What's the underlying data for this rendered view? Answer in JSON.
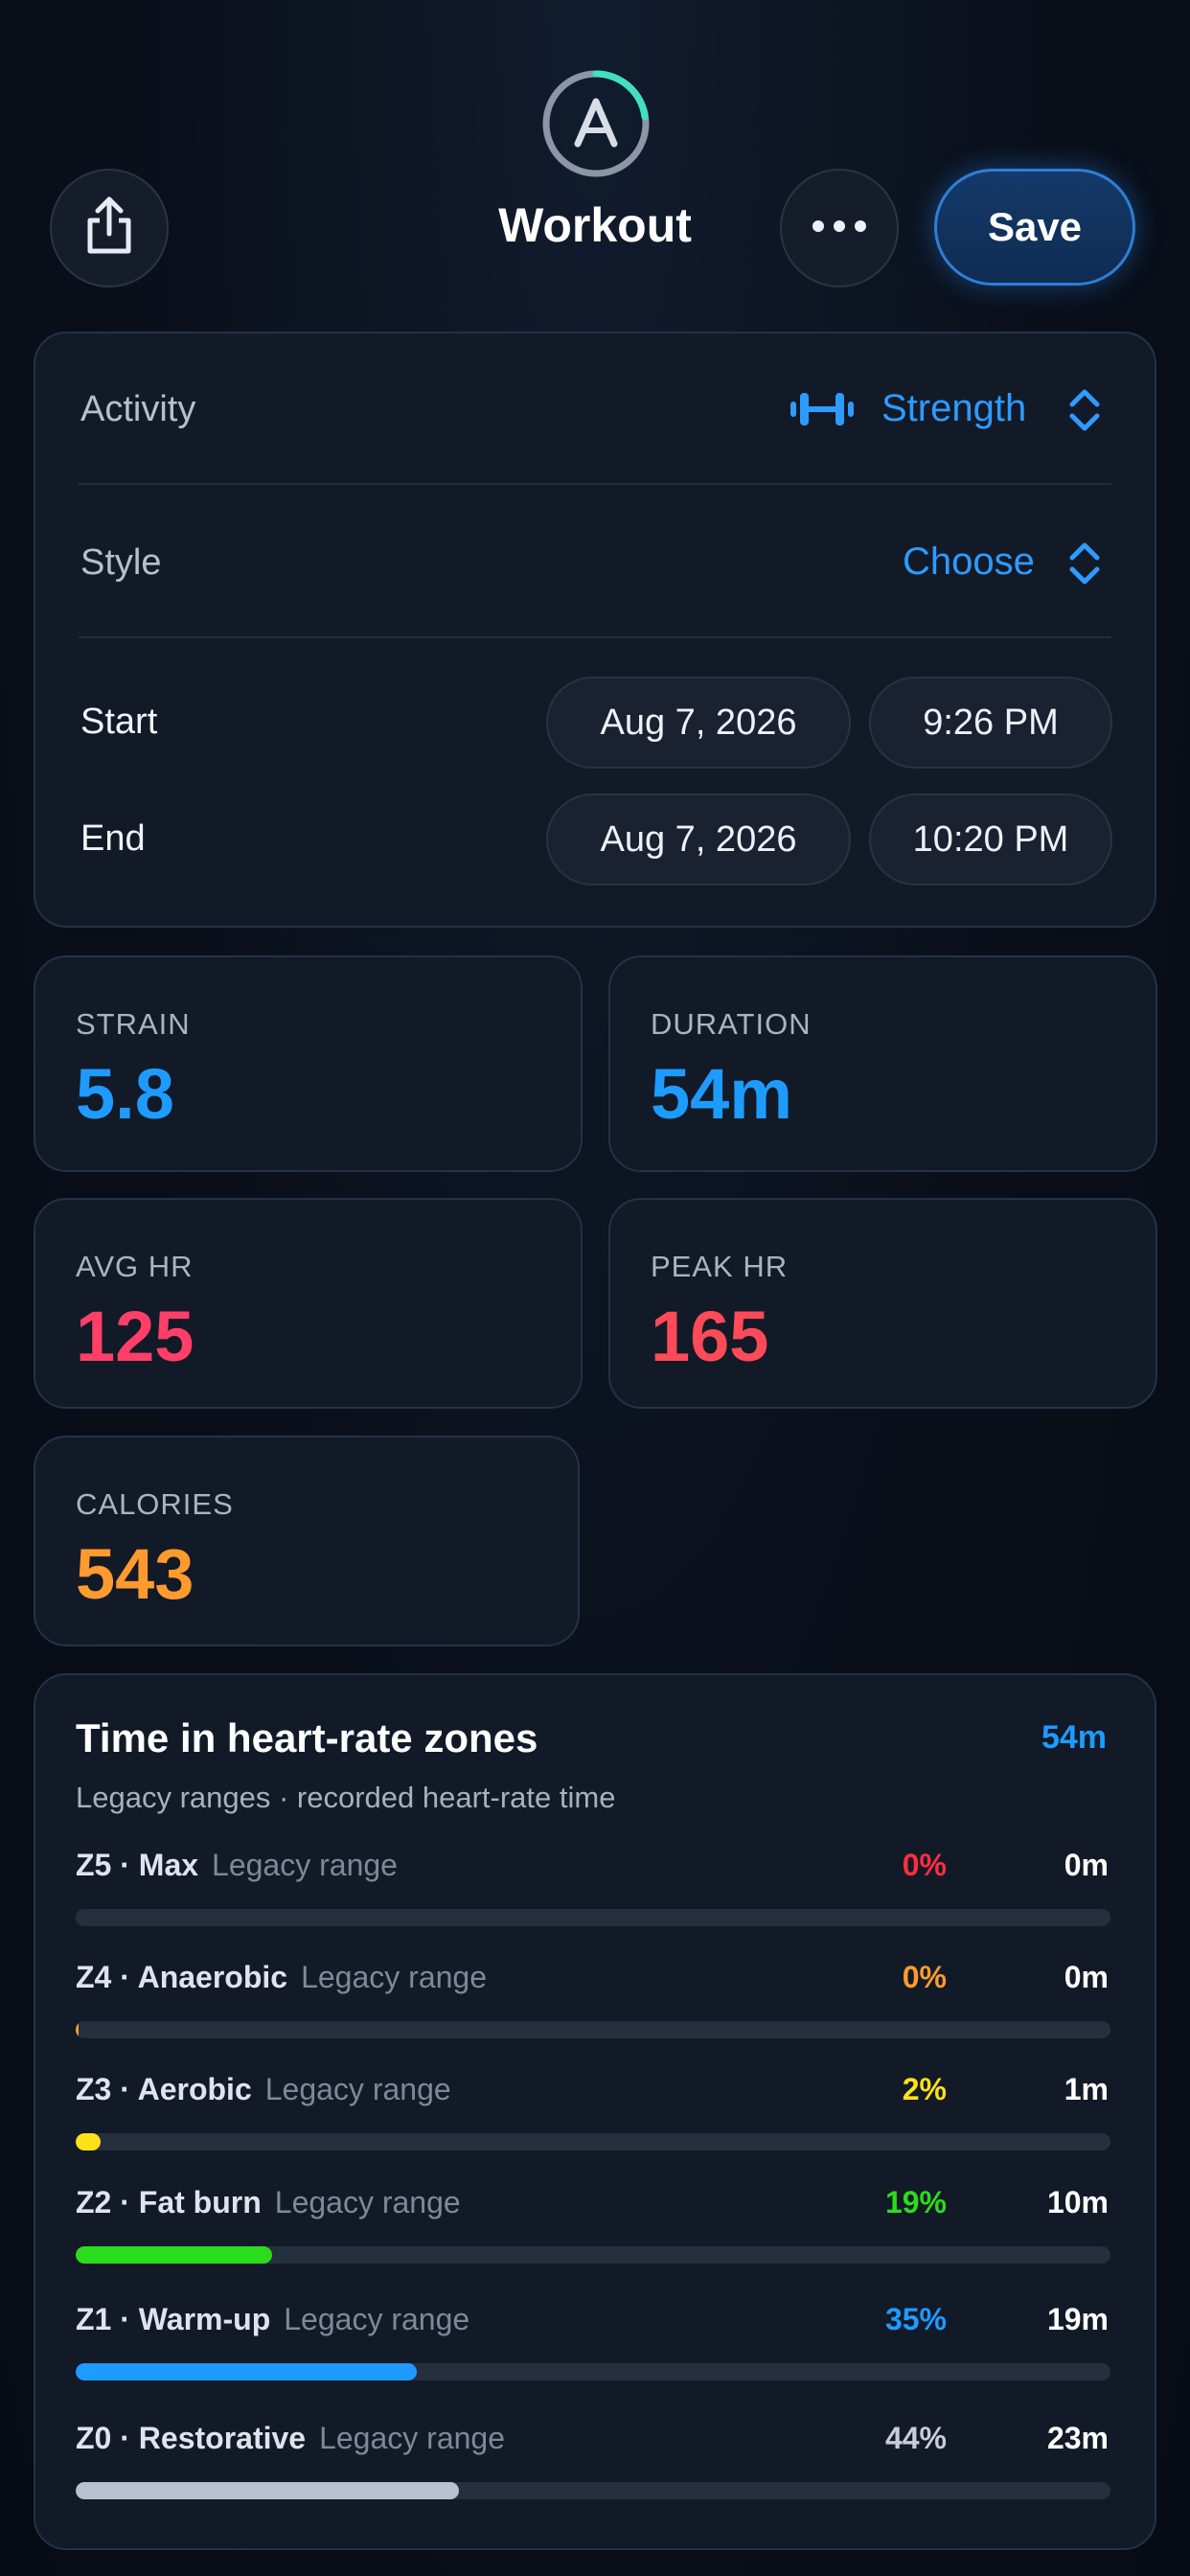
{
  "header": {
    "title": "Workout",
    "save_label": "Save",
    "logo_icon": "app-logo-icon",
    "share_icon": "share-icon",
    "more_icon": "more-icon"
  },
  "details": {
    "activity": {
      "label": "Activity",
      "value": "Strength",
      "icon": "dumbbell-icon"
    },
    "style": {
      "label": "Style",
      "value": "Choose"
    },
    "start": {
      "label": "Start",
      "date": "Aug 7, 2026",
      "time": "9:26 PM"
    },
    "end": {
      "label": "End",
      "date": "Aug 7, 2026",
      "time": "10:20 PM"
    }
  },
  "stats": {
    "strain": {
      "label": "STRAIN",
      "value": "5.8",
      "color": "#1e9bff"
    },
    "duration": {
      "label": "DURATION",
      "value": "54m",
      "color": "#1e9bff"
    },
    "avg_hr": {
      "label": "AVG HR",
      "value": "125",
      "color": "#ff3f68"
    },
    "peak_hr": {
      "label": "PEAK HR",
      "value": "165",
      "color": "#ff4a58"
    },
    "calories": {
      "label": "CALORIES",
      "value": "543",
      "color": "#ff9a2e"
    }
  },
  "zones": {
    "title": "Time in heart-rate zones",
    "total": "54m",
    "subtitle": "Legacy ranges · recorded heart-rate time",
    "items": [
      {
        "name": "Z5 · Max",
        "range": "Legacy range",
        "pct": "0%",
        "time": "0m",
        "fraction": 0.0,
        "color": "#ff2d3f"
      },
      {
        "name": "Z4 · Anaerobic",
        "range": "Legacy range",
        "pct": "0%",
        "time": "0m",
        "fraction": 0.002,
        "color": "#ff9a2e"
      },
      {
        "name": "Z3 · Aerobic",
        "range": "Legacy range",
        "pct": "2%",
        "time": "1m",
        "fraction": 0.024,
        "color": "#ffe01a"
      },
      {
        "name": "Z2 · Fat burn",
        "range": "Legacy range",
        "pct": "19%",
        "time": "10m",
        "fraction": 0.19,
        "color": "#2bdc1c"
      },
      {
        "name": "Z1 · Warm-up",
        "range": "Legacy range",
        "pct": "35%",
        "time": "19m",
        "fraction": 0.33,
        "color": "#1e9bff"
      },
      {
        "name": "Z0 · Restorative",
        "range": "Legacy range",
        "pct": "44%",
        "time": "23m",
        "fraction": 0.37,
        "color": "#b8c0d2",
        "pct_color": "#c8cdd6"
      }
    ]
  }
}
